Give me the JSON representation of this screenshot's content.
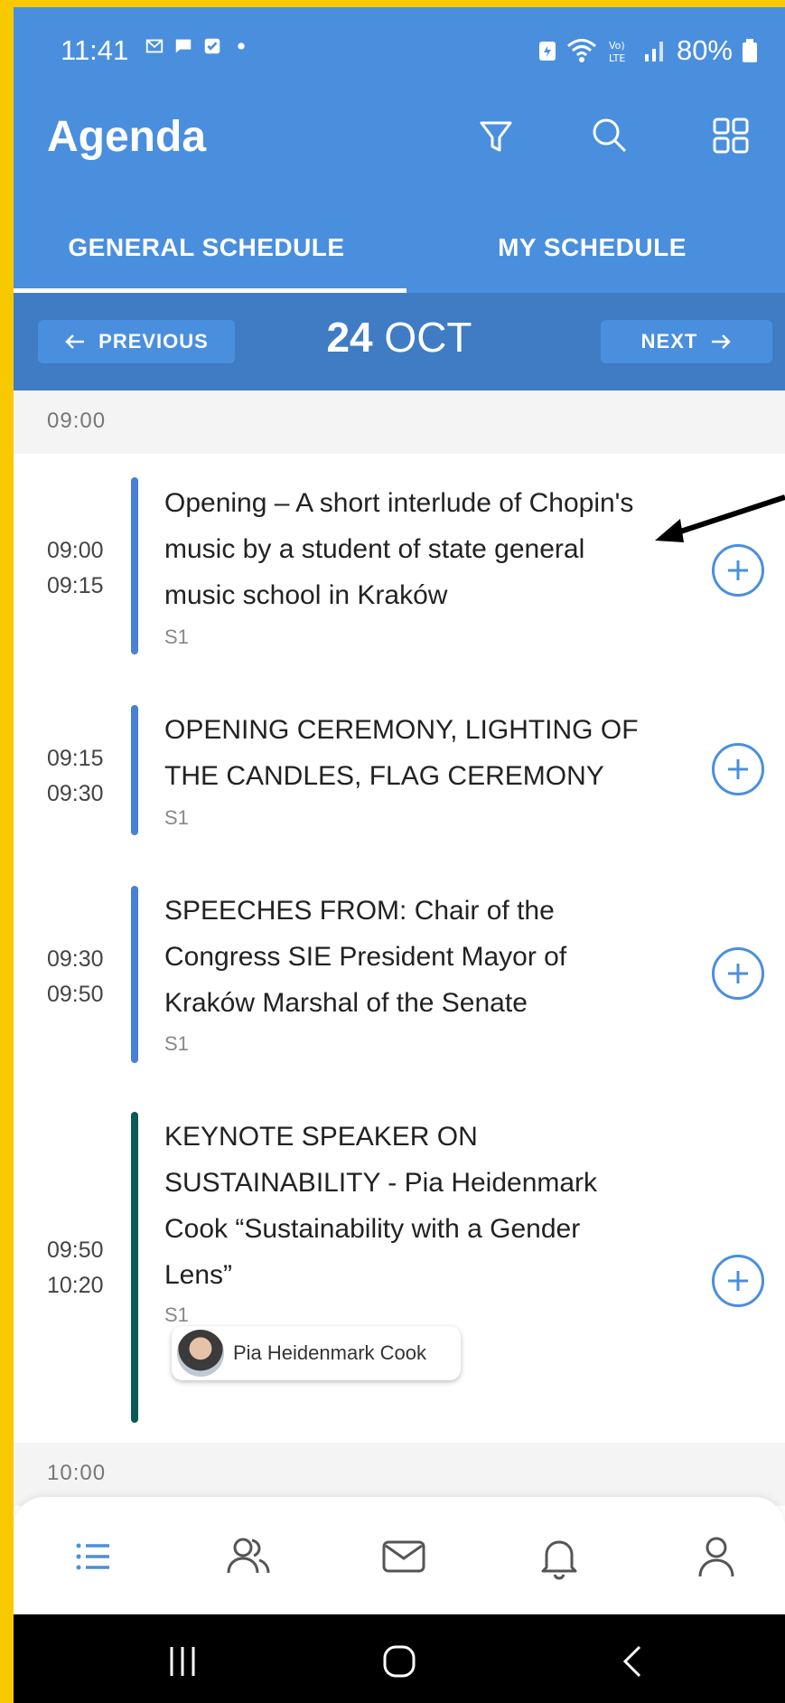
{
  "status_bar": {
    "time": "11:41",
    "battery": "80%"
  },
  "app_bar": {
    "title": "Agenda",
    "icons": [
      "filter-icon",
      "search-icon",
      "grid-icon"
    ]
  },
  "tabs": [
    {
      "label": "GENERAL SCHEDULE",
      "active": true
    },
    {
      "label": "MY SCHEDULE",
      "active": false
    }
  ],
  "date_nav": {
    "previous_label": "PREVIOUS",
    "next_label": "NEXT",
    "day": "24",
    "month": "OCT"
  },
  "time_headers": [
    "09:00",
    "10:00"
  ],
  "sessions": [
    {
      "start": "09:00",
      "end": "09:15",
      "title": "Opening – A short interlude of Chopin's music by a student of state general music school in Kraków",
      "room": "S1",
      "bar_color": "#4a7fd8"
    },
    {
      "start": "09:15",
      "end": "09:30",
      "title": "OPENING CEREMONY, LIGHTING OF THE CANDLES, FLAG CEREMONY",
      "room": "S1",
      "bar_color": "#4a7fd8"
    },
    {
      "start": "09:30",
      "end": "09:50",
      "title": "SPEECHES FROM: Chair of the Congress SIE President Mayor of Kraków Marshal of the Senate",
      "room": "S1",
      "bar_color": "#4a7fd8"
    },
    {
      "start": "09:50",
      "end": "10:20",
      "title": "KEYNOTE SPEAKER ON SUSTAINABILITY - Pia Heidenmark Cook “Sustainability with a Gender Lens”",
      "room": "S1",
      "bar_color": "#0b5a57",
      "speaker": "Pia  Heidenmark Cook"
    }
  ],
  "bottom_nav": [
    "agenda-list-icon",
    "people-icon",
    "mail-icon",
    "bell-icon",
    "profile-icon"
  ],
  "colors": {
    "primary": "#4a8fde",
    "date_bar": "#3f7cc4",
    "frame": "#f9c900"
  }
}
